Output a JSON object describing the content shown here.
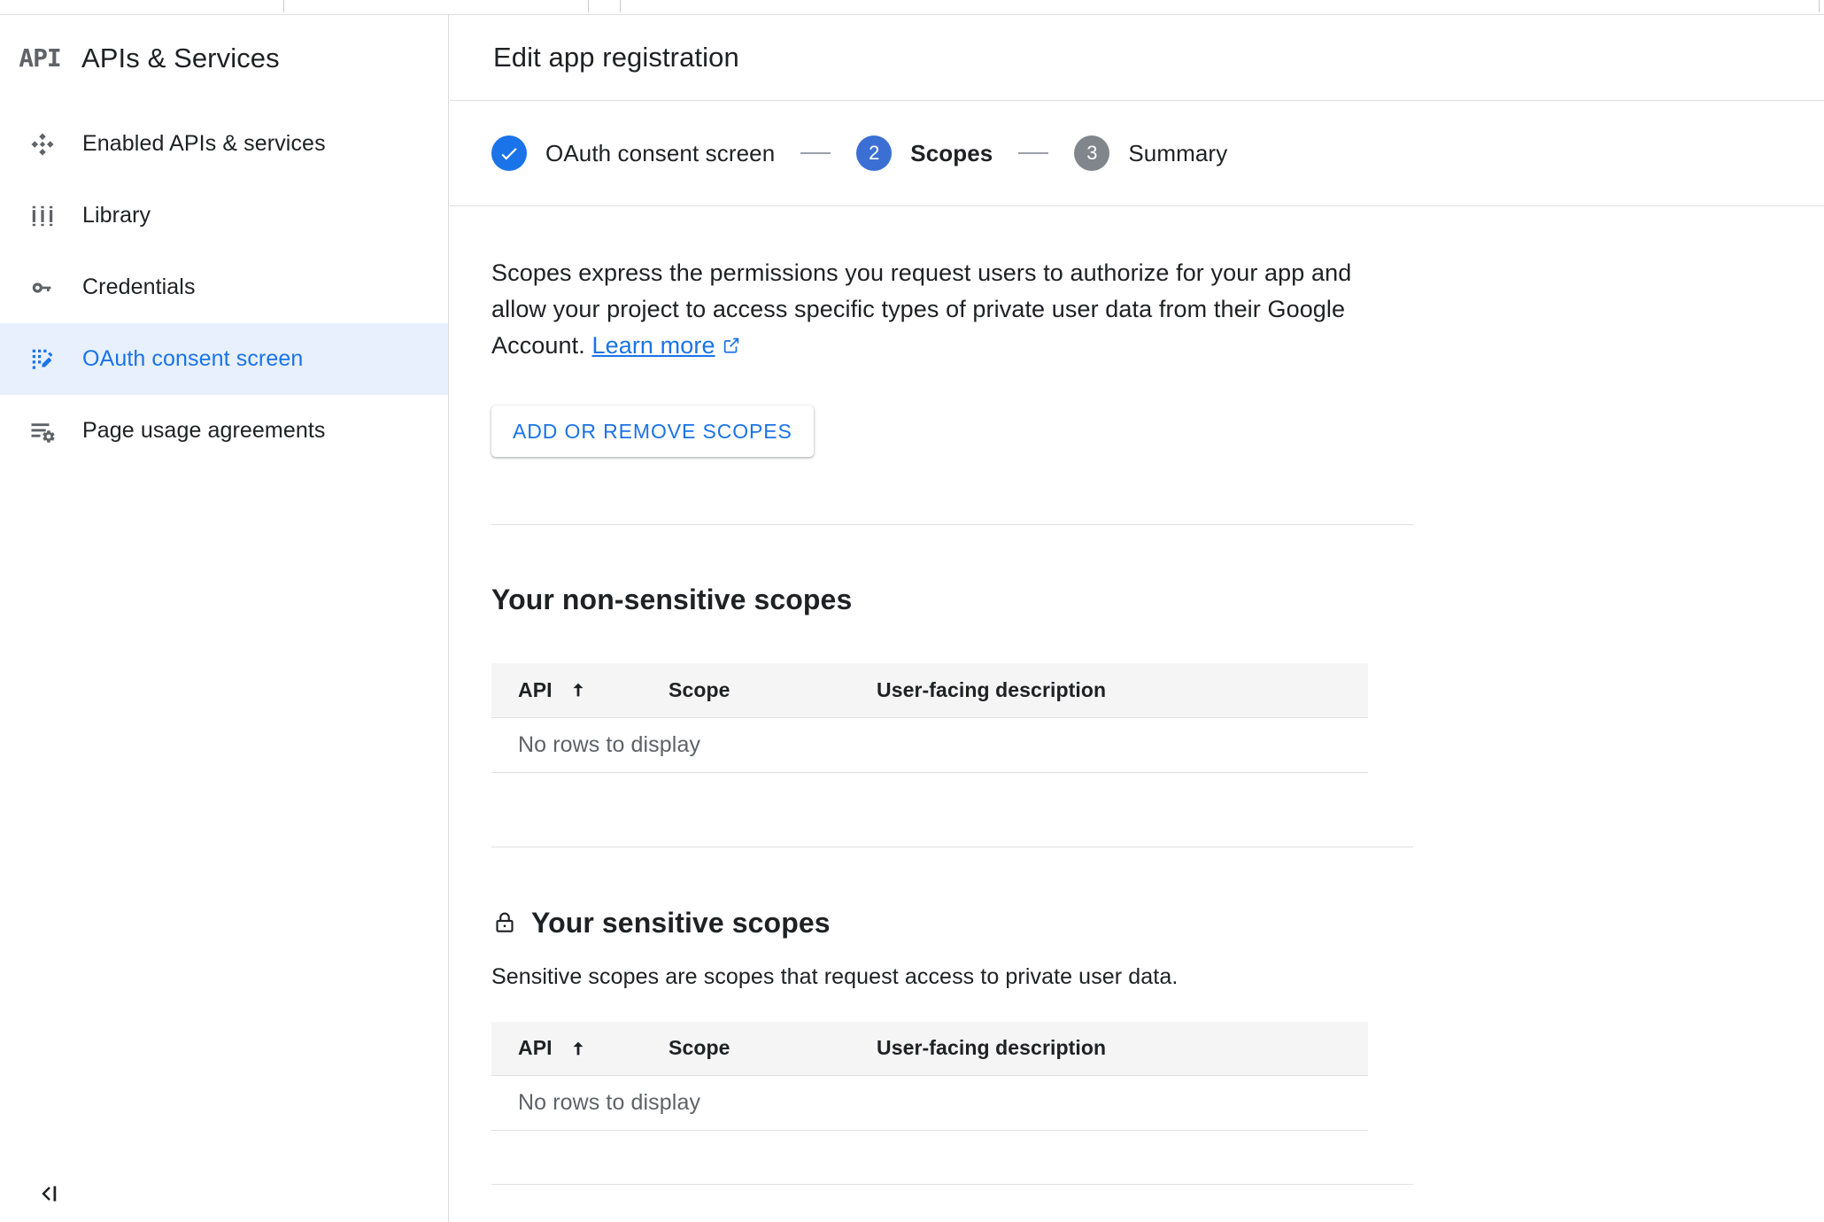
{
  "product": {
    "logo_text": "API",
    "title": "APIs & Services"
  },
  "sidebar": {
    "items": [
      {
        "label": "Enabled APIs & services",
        "icon": "dashboard-diamond-icon",
        "active": false
      },
      {
        "label": "Library",
        "icon": "library-icon",
        "active": false
      },
      {
        "label": "Credentials",
        "icon": "key-icon",
        "active": false
      },
      {
        "label": "OAuth consent screen",
        "icon": "oauth-consent-icon",
        "active": true
      },
      {
        "label": "Page usage agreements",
        "icon": "list-settings-icon",
        "active": false
      }
    ],
    "collapse_icon": "collapse-panel-icon"
  },
  "header": {
    "title": "Edit app registration"
  },
  "stepper": {
    "steps": [
      {
        "number": "1",
        "label": "OAuth consent screen",
        "state": "done",
        "marker": "check-icon"
      },
      {
        "number": "2",
        "label": "Scopes",
        "state": "current",
        "marker": "2"
      },
      {
        "number": "3",
        "label": "Summary",
        "state": "todo",
        "marker": "3"
      }
    ]
  },
  "intro": {
    "text": "Scopes express the permissions you request users to authorize for your app and allow your project to access specific types of private user data from their Google Account.",
    "link_label": "Learn more",
    "link_icon": "external-link-icon"
  },
  "actions": {
    "add_remove_scopes": "ADD OR REMOVE SCOPES"
  },
  "non_sensitive": {
    "heading": "Your non-sensitive scopes",
    "columns": [
      "API",
      "Scope",
      "User-facing description"
    ],
    "sort_column": "API",
    "sort_direction": "ascending",
    "empty_message": "No rows to display",
    "rows": []
  },
  "sensitive": {
    "heading": "Your sensitive scopes",
    "heading_icon": "lock-icon",
    "description": "Sensitive scopes are scopes that request access to private user data.",
    "columns": [
      "API",
      "Scope",
      "User-facing description"
    ],
    "sort_column": "API",
    "sort_direction": "ascending",
    "empty_message": "No rows to display",
    "rows": []
  },
  "colors": {
    "accent_blue": "#1a73e8",
    "active_nav_bg": "#e8f0fe",
    "step_current": "#3b6fd4",
    "step_todo": "#80868b",
    "table_header_bg": "#f5f5f5",
    "divider": "#e0e0e0",
    "muted_text": "#5f6368"
  }
}
